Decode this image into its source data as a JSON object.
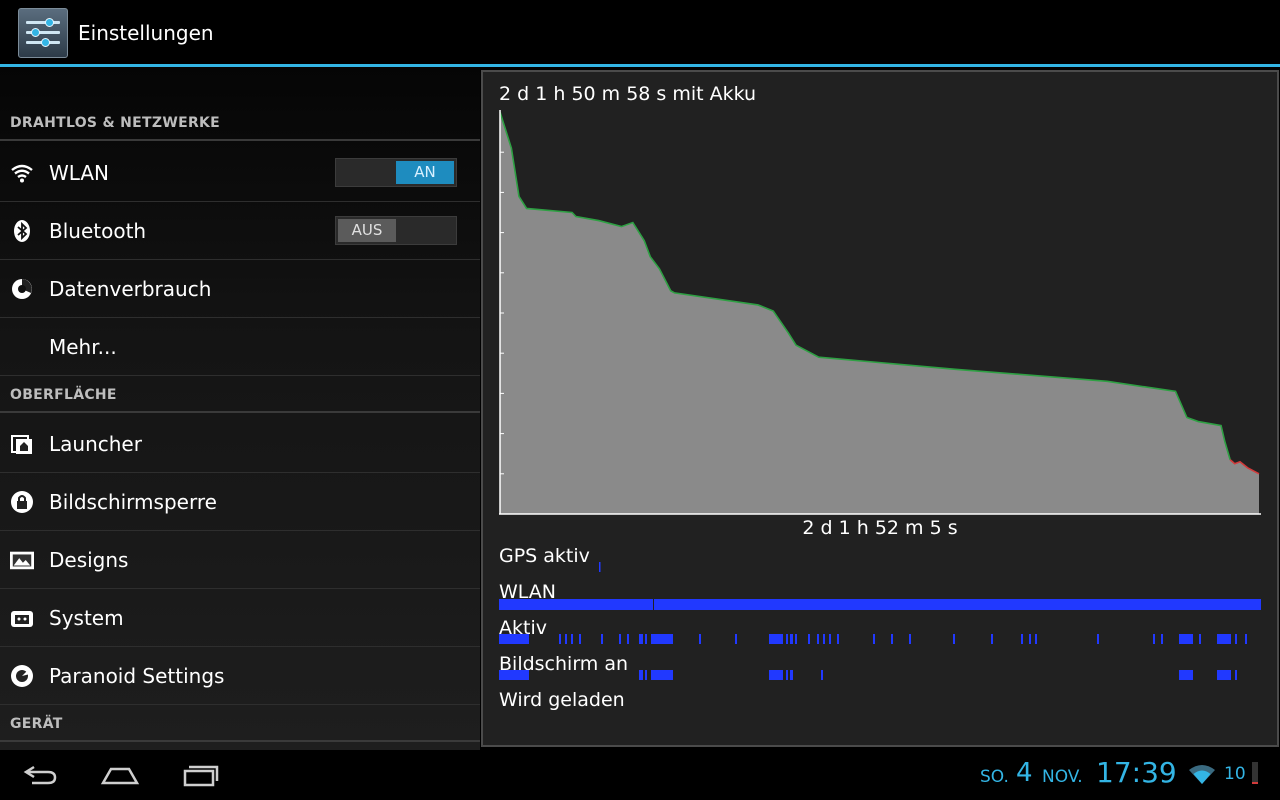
{
  "actionbar": {
    "title": "Einstellungen"
  },
  "sections": {
    "wireless": "DRAHTLOS & NETZWERKE",
    "ui": "OBERFLÄCHE",
    "device": "GERÄT"
  },
  "items": {
    "wlan": {
      "label": "WLAN",
      "toggle": "AN"
    },
    "bluetooth": {
      "label": "Bluetooth",
      "toggle": "AUS"
    },
    "data": {
      "label": "Datenverbrauch"
    },
    "more": {
      "label": "Mehr..."
    },
    "launcher": {
      "label": "Launcher"
    },
    "lockscreen": {
      "label": "Bildschirmsperre"
    },
    "themes": {
      "label": "Designs"
    },
    "system": {
      "label": "System"
    },
    "paranoid": {
      "label": "Paranoid Settings"
    }
  },
  "battery": {
    "duration_label": "2 d 1 h 50 m 58 s mit Akku",
    "timeline_label": "2 d 1 h 52 m 5 s",
    "tracks": [
      "GPS aktiv",
      "WLAN",
      "Aktiv",
      "Bildschirm an",
      "Wird geladen"
    ],
    "colors": {
      "fill": "#8a8a8a",
      "line": "#2ea043",
      "low": "#d23b3b",
      "track": "#2139ff"
    }
  },
  "chart_data": {
    "type": "area",
    "title": "",
    "xlabel": "2 d 1 h 52 m 5 s",
    "ylabel": "",
    "x_unit": "fraction of elapsed time",
    "y_unit": "battery level (%)",
    "ylim": [
      0,
      100
    ],
    "series": [
      {
        "x": [
          0.0,
          0.005,
          0.015,
          0.02,
          0.025,
          0.035,
          0.095,
          0.1,
          0.13,
          0.16,
          0.175,
          0.18,
          0.19,
          0.198,
          0.21,
          0.225,
          0.23,
          0.34,
          0.36,
          0.38,
          0.39,
          0.42,
          0.6,
          0.8,
          0.89,
          0.905,
          0.92,
          0.95,
          0.955,
          0.962
        ],
        "y": [
          100,
          97,
          91,
          85,
          79,
          76,
          75,
          74,
          73,
          71.5,
          72.5,
          71,
          68,
          64,
          61,
          55.5,
          55,
          52,
          50.5,
          45,
          42,
          39,
          36,
          33,
          30.5,
          24,
          23,
          22,
          18,
          13.5
        ]
      },
      {
        "x": [
          0.962,
          0.968,
          0.975,
          0.985,
          1.0
        ],
        "y": [
          13.5,
          12.5,
          13,
          11.5,
          10
        ]
      }
    ]
  },
  "navbar": {
    "weekday": "SO.",
    "day": "4",
    "month": "NOV.",
    "time": "17:39",
    "battery_pct": "10",
    "battery_level": 10
  }
}
